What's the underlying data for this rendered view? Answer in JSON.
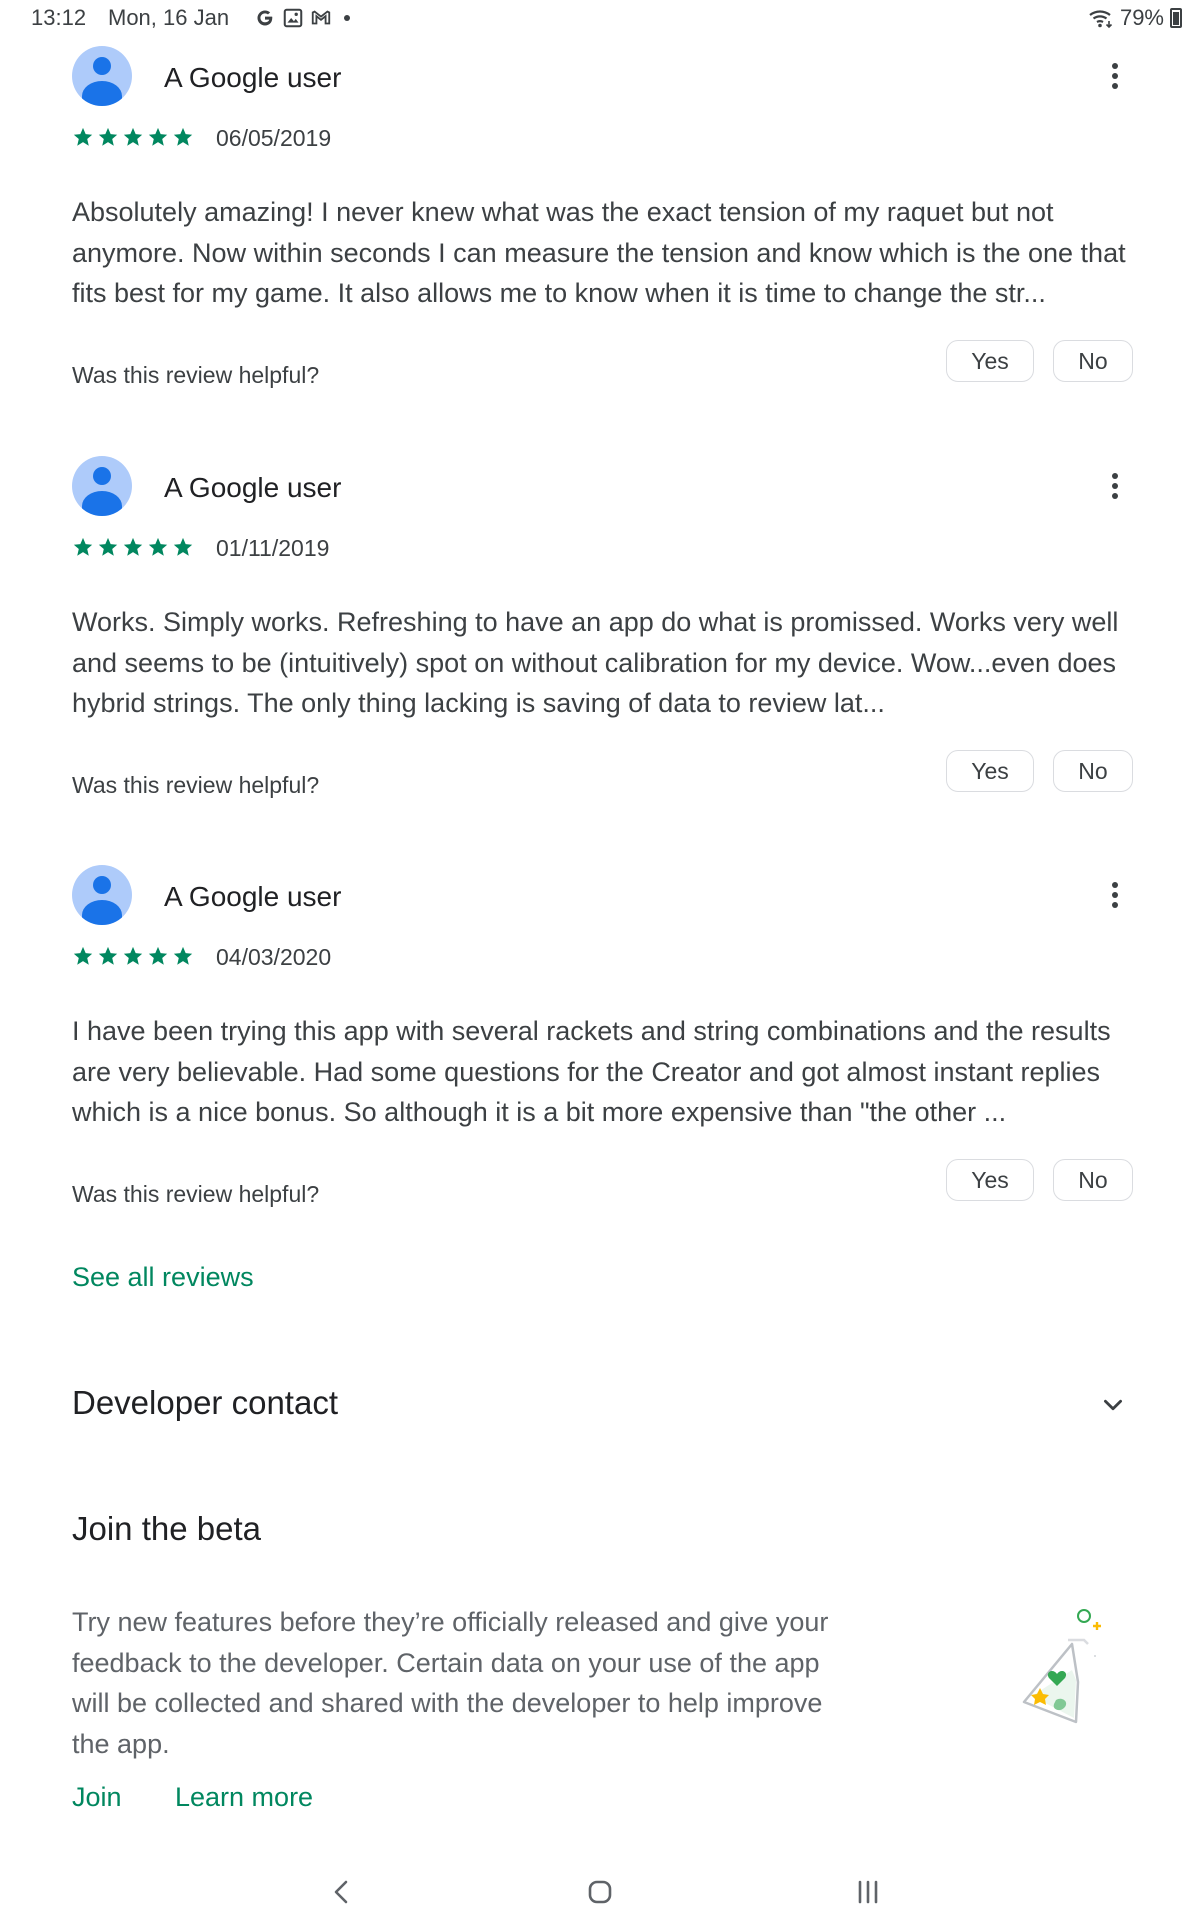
{
  "status_bar": {
    "time": "13:12",
    "date": "Mon, 16 Jan",
    "notification_icons": [
      "google-icon",
      "gallery-icon",
      "gmail-icon"
    ],
    "battery": "79%"
  },
  "reviews": [
    {
      "author": "A Google user",
      "rating": 5,
      "date": "06/05/2019",
      "text": "Absolutely amazing! I never knew what was the exact tension of my raquet but not anymore. Now within seconds I can measure the tension and know which is the one that fits best for my game. It also allows me to know when it is time to change the str...",
      "helpful_prompt": "Was this review helpful?",
      "yes_label": "Yes",
      "no_label": "No"
    },
    {
      "author": "A Google user",
      "rating": 5,
      "date": "01/11/2019",
      "text": "Works. Simply works. Refreshing to have an app do what is promissed. Works very well and seems to be (intuitively) spot on without calibration for my device. Wow...even does hybrid strings. The only thing lacking is saving of data to review lat...",
      "helpful_prompt": "Was this review helpful?",
      "yes_label": "Yes",
      "no_label": "No"
    },
    {
      "author": "A Google user",
      "rating": 5,
      "date": "04/03/2020",
      "text": "I have been trying this app with several rackets and string combinations and the results are very believable. Had some questions for the Creator and got almost instant replies which is a nice bonus. So although it is a bit more expensive than \"the other ...",
      "helpful_prompt": "Was this review helpful?",
      "yes_label": "Yes",
      "no_label": "No"
    }
  ],
  "see_all_reviews": "See all reviews",
  "developer_contact": {
    "title": "Developer contact",
    "icon": "chevron-down-icon"
  },
  "beta": {
    "title": "Join the beta",
    "description": "Try new features before they’re officially released and give your feedback to the developer. Certain data on your use of the app will be collected and shared with the developer to help improve the app.",
    "join_label": "Join",
    "learn_more_label": "Learn more"
  },
  "nav_bar": {
    "icons": [
      "back-icon",
      "home-icon",
      "recents-icon"
    ]
  },
  "colors": {
    "accent_green": "#01875f",
    "avatar_bg": "#aecbfa",
    "avatar_fg": "#1a73e8",
    "text_primary": "#202124",
    "text_secondary": "#3c4043"
  }
}
